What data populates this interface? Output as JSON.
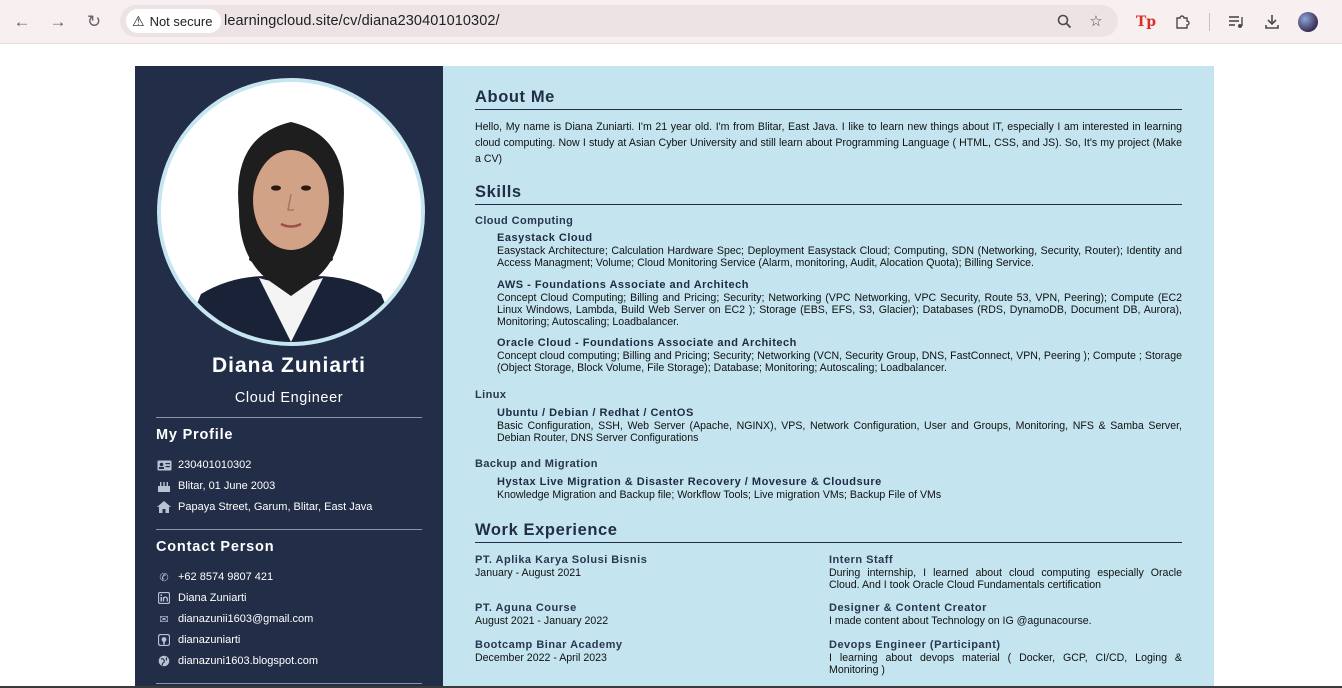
{
  "browser": {
    "security_label": "Not secure",
    "url": "learningcloud.site/cv/diana230401010302/",
    "icons": [
      "back-icon",
      "forward-icon",
      "reload-icon",
      "warning-icon",
      "zoom-icon",
      "star-icon",
      "tp-extension-icon",
      "puzzle-icon",
      "playlist-icon",
      "download-icon",
      "profile-avatar"
    ],
    "tp_label": "Tp"
  },
  "profile": {
    "name": "Diana Zuniarti",
    "role": "Cloud Engineer",
    "my_profile_heading": "My Profile",
    "details": [
      {
        "icon": "id-card-icon",
        "text": "230401010302"
      },
      {
        "icon": "birthday-cake-icon",
        "text": "Blitar, 01 June 2003"
      },
      {
        "icon": "home-icon",
        "text": "Papaya Street, Garum, Blitar, East Java"
      }
    ],
    "contact_heading": "Contact Person",
    "contacts": [
      {
        "icon": "phone-icon",
        "text": "+62 8574 9807 421"
      },
      {
        "icon": "linkedin-icon",
        "text": "Diana Zuniarti"
      },
      {
        "icon": "email-icon",
        "text": "dianazunii1603@gmail.com"
      },
      {
        "icon": "github-icon",
        "text": "dianazuniarti"
      },
      {
        "icon": "globe-icon",
        "text": "dianazuni1603.blogspot.com"
      }
    ]
  },
  "about": {
    "title": "About Me",
    "text": "Hello, My name is Diana Zuniarti. I'm 21 year old. I'm from Blitar, East Java. I like to learn new things about IT, especially I am interested in learning cloud computing. Now I study at Asian Cyber University and still learn about Programming Language ( HTML, CSS, and JS). So, It's my project (Make a CV)"
  },
  "skills": {
    "title": "Skills",
    "categories": [
      {
        "name": "Cloud Computing",
        "items": [
          {
            "title": "Easystack Cloud",
            "desc": "Easystack Architecture; Calculation Hardware Spec; Deployment Easystack Cloud; Computing, SDN (Networking, Security, Router); Identity and Access Managment; Volume; Cloud Monitoring Service (Alarm, monitoring, Audit, Alocation Quota); Billing Service."
          },
          {
            "title": "AWS - Foundations Associate and Architech",
            "desc": "Concept Cloud Computing; Billing and Pricing; Security; Networking (VPC Networking, VPC Security, Route 53, VPN, Peering); Compute (EC2 Linux Windows, Lambda, Build Web Server on EC2 ); Storage (EBS, EFS, S3, Glacier); Databases (RDS, DynamoDB, Document DB, Aurora), Monitoring; Autoscaling; Loadbalancer."
          },
          {
            "title": "Oracle Cloud - Foundations Associate and Architech",
            "desc": "Concept cloud computing; Billing and Pricing; Security; Networking (VCN, Security Group, DNS, FastConnect, VPN, Peering ); Compute ; Storage (Object Storage, Block Volume, File Storage); Database; Monitoring; Autoscaling; Loadbalancer."
          }
        ]
      },
      {
        "name": "Linux",
        "items": [
          {
            "title": "Ubuntu / Debian / Redhat / CentOS",
            "desc": "Basic Configuration, SSH, Web Server (Apache, NGINX), VPS, Network Configuration, User and Groups, Monitoring, NFS & Samba Server, Debian Router, DNS Server Configurations"
          }
        ]
      },
      {
        "name": "Backup and Migration",
        "items": [
          {
            "title": "Hystax Live Migration & Disaster Recovery / Movesure & Cloudsure",
            "desc": "Knowledge Migration and Backup file; Workflow Tools; Live migration VMs; Backup File of VMs"
          }
        ]
      }
    ]
  },
  "work": {
    "title": "Work Experience",
    "rows": [
      {
        "company": "PT. Aplika Karya Solusi Bisnis",
        "period": "January - August 2021",
        "position": "Intern Staff",
        "desc": "During internship, I learned about cloud computing especially Oracle Cloud. And I took Oracle Cloud Fundamentals certification"
      },
      {
        "company": "PT. Aguna Course",
        "period": "August 2021 - January 2022",
        "position": "Designer & Content Creator",
        "desc": "I made content about Technology on IG @agunacourse."
      },
      {
        "company": "Bootcamp Binar Academy",
        "period": "December 2022 - April 2023",
        "position": "Devops Engineer (Participant)",
        "desc": "I learning about devops material ( Docker, GCP, CI/CD, Loging & Monitoring )"
      }
    ]
  }
}
